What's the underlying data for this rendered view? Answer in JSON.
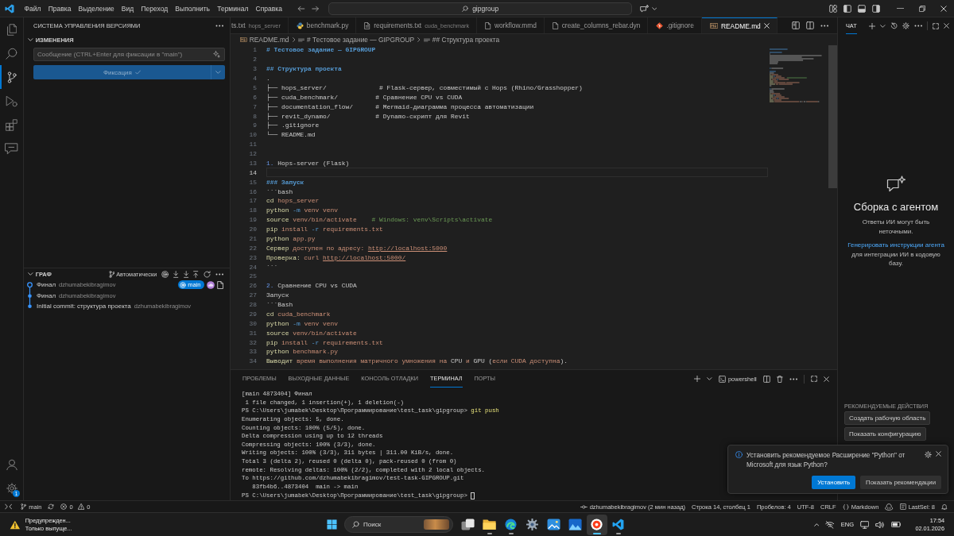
{
  "title_bar": {
    "menu": [
      "Файл",
      "Правка",
      "Выделение",
      "Вид",
      "Переход",
      "Выполнить",
      "Терминал",
      "Справка"
    ],
    "command_center": "gipgroup"
  },
  "activity_bar": {
    "items": [
      {
        "kind": "files",
        "selected": false
      },
      {
        "kind": "search",
        "selected": false
      },
      {
        "kind": "source-control",
        "selected": true
      },
      {
        "kind": "run",
        "selected": false
      },
      {
        "kind": "extensions",
        "selected": false
      },
      {
        "kind": "chat",
        "selected": false
      }
    ],
    "bottom": [
      {
        "kind": "account"
      },
      {
        "kind": "settings",
        "badge": "1"
      }
    ]
  },
  "source_control": {
    "title": "СИСТЕМА УПРАВЛЕНИЯ ВЕРСИЯМИ",
    "changes": {
      "title": "ИЗМЕНЕНИЯ",
      "expanded": true,
      "message": {
        "placeholder": "Сообщение (CTRL+Enter для фиксации в \"main\")"
      },
      "commit_button": {
        "label": "Фиксация",
        "disabled": true
      }
    },
    "graph": {
      "title": "ГРАФ",
      "expanded": true,
      "mode": "Автоматически",
      "commits": [
        {
          "message": "Финал",
          "author": "dzhumabekibragimov",
          "head": true,
          "branch": "main",
          "remote": true,
          "actions": true
        },
        {
          "message": "Финал",
          "author": "dzhumabekibragimov",
          "head": false,
          "remote": false,
          "actions": false
        },
        {
          "message": "Initial commit: структура проекта",
          "author": "dzhumabekibragimov",
          "head": false,
          "remote": false,
          "actions": false
        }
      ]
    }
  },
  "editor": {
    "tabs": [
      {
        "label": "ts.txt",
        "description": "hops_server",
        "kind": "none",
        "selected": false
      },
      {
        "label": "benchmark.py",
        "kind": "python",
        "selected": false
      },
      {
        "label": "requirements.txt",
        "description": "cuda_benchmark",
        "kind": "lines",
        "selected": false
      },
      {
        "label": "workflow.mmd",
        "kind": "file",
        "selected": false
      },
      {
        "label": "create_columns_rebar.dyn",
        "kind": "file",
        "selected": false
      },
      {
        "label": ".gitignore",
        "kind": "git",
        "selected": false
      },
      {
        "label": "README.md",
        "kind": "markdown",
        "selected": true
      }
    ],
    "breadcrumb": [
      {
        "label": "README.md",
        "kind": "markdown"
      },
      {
        "label": "# Тестовое задание — GIPGROUP",
        "kind": "symbol"
      },
      {
        "label": "## Структура проекта",
        "kind": "symbol"
      }
    ],
    "lines": [
      {
        "number": "1",
        "current": false,
        "segments": [
          {
            "kind": "heading",
            "text": "# Тестовое задание — GIPGROUP"
          }
        ]
      },
      {
        "number": "2",
        "current": false
      },
      {
        "number": "3",
        "current": false,
        "segments": [
          {
            "kind": "heading",
            "text": "## Структура проекта"
          }
        ]
      },
      {
        "number": "4",
        "current": false,
        "segments": [
          {
            "kind": "text",
            "text": "."
          }
        ]
      },
      {
        "number": "5",
        "current": false,
        "segments": [
          {
            "kind": "text",
            "text": "├── hops_server/              # Flask-сервер, совместимый с Hops (Rhino/Grasshopper)"
          }
        ]
      },
      {
        "number": "6",
        "current": false,
        "segments": [
          {
            "kind": "text",
            "text": "├── cuda_benchmark/          # Сравнение CPU vs CUDA"
          }
        ]
      },
      {
        "number": "7",
        "current": false,
        "segments": [
          {
            "kind": "text",
            "text": "├── documentation_flow/      # Mermaid-диаграмма процесса автоматизации"
          }
        ]
      },
      {
        "number": "8",
        "current": false,
        "segments": [
          {
            "kind": "text",
            "text": "├── revit_dynamo/            # Dynamo-скрипт для Revit"
          }
        ]
      },
      {
        "number": "9",
        "current": false,
        "segments": [
          {
            "kind": "text",
            "text": "├── .gitignore"
          }
        ]
      },
      {
        "number": "10",
        "current": false,
        "segments": [
          {
            "kind": "text",
            "text": "└── README.md"
          }
        ]
      },
      {
        "number": "11",
        "current": false
      },
      {
        "number": "12",
        "current": false
      },
      {
        "number": "13",
        "current": false,
        "segments": [
          {
            "kind": "marker",
            "text": "1."
          },
          {
            "kind": "text",
            "text": " Hops-server (Flask)"
          }
        ]
      },
      {
        "number": "14",
        "current": true
      },
      {
        "number": "15",
        "current": false,
        "segments": [
          {
            "kind": "heading",
            "text": "### Запуск"
          }
        ]
      },
      {
        "number": "16",
        "current": false,
        "segments": [
          {
            "kind": "text",
            "text": "```bash"
          }
        ]
      },
      {
        "number": "17",
        "current": false,
        "segments": [
          {
            "kind": "command",
            "text": "cd"
          },
          {
            "kind": "string",
            "text": " hops_server"
          }
        ]
      },
      {
        "number": "18",
        "current": false,
        "segments": [
          {
            "kind": "command",
            "text": "python"
          },
          {
            "kind": "flag",
            "text": " -m"
          },
          {
            "kind": "string",
            "text": " venv venv"
          }
        ]
      },
      {
        "number": "19",
        "current": false,
        "segments": [
          {
            "kind": "command",
            "text": "source"
          },
          {
            "kind": "string",
            "text": " venv/bin/activate"
          },
          {
            "kind": "comment",
            "text": "    # Windows: venv\\Scripts\\activate"
          }
        ]
      },
      {
        "number": "20",
        "current": false,
        "segments": [
          {
            "kind": "command",
            "text": "pip"
          },
          {
            "kind": "string",
            "text": " install"
          },
          {
            "kind": "flag",
            "text": " -r"
          },
          {
            "kind": "string",
            "text": " requirements.txt"
          }
        ]
      },
      {
        "number": "21",
        "current": false,
        "segments": [
          {
            "kind": "command",
            "text": "python"
          },
          {
            "kind": "string",
            "text": " app.py"
          }
        ]
      },
      {
        "number": "22",
        "current": false,
        "segments": [
          {
            "kind": "command",
            "text": "Сервер"
          },
          {
            "kind": "string",
            "text": " доступен по адресу: "
          },
          {
            "kind": "link",
            "text": "http://localhost:5000"
          }
        ]
      },
      {
        "number": "23",
        "current": false,
        "segments": [
          {
            "kind": "command",
            "text": "Проверка:"
          },
          {
            "kind": "string",
            "text": " curl "
          },
          {
            "kind": "link",
            "text": "http://localhost:5000/"
          }
        ]
      },
      {
        "number": "24",
        "current": false,
        "segments": [
          {
            "kind": "text",
            "text": "```"
          }
        ]
      },
      {
        "number": "25",
        "current": false
      },
      {
        "number": "26",
        "current": false,
        "segments": [
          {
            "kind": "marker",
            "text": "2."
          },
          {
            "kind": "text",
            "text": " Сравнение CPU vs CUDA"
          }
        ]
      },
      {
        "number": "27",
        "current": false,
        "segments": [
          {
            "kind": "text",
            "text": "Запуск"
          }
        ]
      },
      {
        "number": "28",
        "current": false,
        "segments": [
          {
            "kind": "text",
            "text": "```Bash"
          }
        ]
      },
      {
        "number": "29",
        "current": false,
        "segments": [
          {
            "kind": "command",
            "text": "cd"
          },
          {
            "kind": "string",
            "text": " cuda_benchmark"
          }
        ]
      },
      {
        "number": "30",
        "current": false,
        "segments": [
          {
            "kind": "command",
            "text": "python"
          },
          {
            "kind": "flag",
            "text": " -m"
          },
          {
            "kind": "string",
            "text": " venv venv"
          }
        ]
      },
      {
        "number": "31",
        "current": false,
        "segments": [
          {
            "kind": "command",
            "text": "source"
          },
          {
            "kind": "string",
            "text": " venv/bin/activate"
          }
        ]
      },
      {
        "number": "32",
        "current": false,
        "segments": [
          {
            "kind": "command",
            "text": "pip"
          },
          {
            "kind": "string",
            "text": " install"
          },
          {
            "kind": "flag",
            "text": " -r"
          },
          {
            "kind": "string",
            "text": " requirements.txt"
          }
        ]
      },
      {
        "number": "33",
        "current": false,
        "segments": [
          {
            "kind": "command",
            "text": "python"
          },
          {
            "kind": "string",
            "text": " benchmark.py"
          }
        ]
      },
      {
        "number": "34",
        "current": false,
        "segments": [
          {
            "kind": "command",
            "text": "Выводит"
          },
          {
            "kind": "string",
            "text": " время выполнения матричного умножения на "
          },
          {
            "kind": "text",
            "text": "CPU"
          },
          {
            "kind": "string",
            "text": " и "
          },
          {
            "kind": "text",
            "text": "GPU"
          },
          {
            "kind": "text",
            "text": " ("
          },
          {
            "kind": "string",
            "text": "если CUDA доступна"
          },
          {
            "kind": "text",
            "text": ")."
          }
        ]
      }
    ]
  },
  "panel": {
    "tabs": [
      {
        "label": "ПРОБЛЕМЫ",
        "selected": false
      },
      {
        "label": "ВЫХОДНЫЕ ДАННЫЕ",
        "selected": false
      },
      {
        "label": "КОНСОЛЬ ОТЛАДКИ",
        "selected": false
      },
      {
        "label": "ТЕРМИНАЛ",
        "selected": true
      },
      {
        "label": "ПОРТЫ",
        "selected": false
      }
    ],
    "shell": "powershell",
    "terminal": {
      "cursor": true,
      "lines": [
        [
          {
            "kind": "output",
            "text": "[main 4873404] Финал"
          }
        ],
        [
          {
            "kind": "output",
            "text": " 1 file changed, 1 insertion(+), 1 deletion(-)"
          }
        ],
        [
          {
            "kind": "output",
            "text": "PS C:\\Users\\jumabek\\Desktop\\Программирование\\test_task\\gipgroup> "
          },
          {
            "kind": "command",
            "text": "git push"
          }
        ],
        [
          {
            "kind": "output",
            "text": "Enumerating objects: 5, done."
          }
        ],
        [
          {
            "kind": "output",
            "text": "Counting objects: 100% (5/5), done."
          }
        ],
        [
          {
            "kind": "output",
            "text": "Delta compression using up to 12 threads"
          }
        ],
        [
          {
            "kind": "output",
            "text": "Compressing objects: 100% (3/3), done."
          }
        ],
        [
          {
            "kind": "output",
            "text": "Writing objects: 100% (3/3), 311 bytes | 311.00 KiB/s, done."
          }
        ],
        [
          {
            "kind": "output",
            "text": "Total 3 (delta 2), reused 0 (delta 0), pack-reused 0 (from 0)"
          }
        ],
        [
          {
            "kind": "output",
            "text": "remote: Resolving deltas: 100% (2/2), completed with 2 local objects."
          }
        ],
        [
          {
            "kind": "output",
            "text": "To https://github.com/dzhumabekibragimov/test-task-GIPGROUP.git"
          }
        ],
        [
          {
            "kind": "output",
            "text": "   83fb4b6..4873404  main -> main"
          }
        ],
        [
          {
            "kind": "output",
            "text": "PS C:\\Users\\jumabek\\Desktop\\Программирование\\test_task\\gipgroup> "
          }
        ]
      ]
    }
  },
  "chat": {
    "tabs": [
      {
        "label": "ЧАТ",
        "selected": true
      }
    ],
    "title": "Сборка с агентом",
    "note": "Ответы ИИ могут быть неточными.",
    "hint": {
      "link": "Генерировать инструкции агента",
      "text": "для интеграции ИИ в кодовую базу."
    },
    "recommended": {
      "title": "РЕКОМЕНДУЕМЫЕ ДЕЙСТВИЯ",
      "actions": [
        "Создать рабочую область",
        "Показать конфигурацию"
      ]
    }
  },
  "notification": {
    "message": "Установить рекомендуемое Расширение \"Python\" от Microsoft для язык Python?",
    "buttons": [
      {
        "label": "Установить",
        "primary": true
      },
      {
        "label": "Показать рекомендации",
        "primary": false
      }
    ]
  },
  "status_bar": {
    "branch": "main",
    "errors": "0",
    "warnings": "0",
    "items": [
      {
        "kind": "blame",
        "label": "dzhumabekibragimov (2 мин назад)"
      },
      {
        "kind": "text",
        "label": "Строка 14, столбец 1"
      },
      {
        "kind": "text",
        "label": "Пробелов: 4"
      },
      {
        "kind": "text",
        "label": "UTF-8"
      },
      {
        "kind": "text",
        "label": "CRLF"
      },
      {
        "kind": "language",
        "label": "Markdown"
      },
      {
        "kind": "copilot"
      },
      {
        "kind": "lastsel",
        "label": "LastSel: 8"
      },
      {
        "kind": "bell"
      }
    ]
  },
  "taskbar": {
    "notice": {
      "title": "Предупрежден...",
      "text": "Только выпуще..."
    },
    "search": {
      "placeholder": "Поиск"
    },
    "apps": [
      {
        "kind": "task-view",
        "running": false,
        "selected": false
      },
      {
        "kind": "folder",
        "running": true,
        "selected": false
      },
      {
        "kind": "swirl",
        "running": true,
        "selected": false
      },
      {
        "kind": "gear",
        "running": false,
        "selected": false
      },
      {
        "kind": "photo",
        "running": false,
        "selected": false
      },
      {
        "kind": "landscape",
        "running": false,
        "selected": false
      },
      {
        "kind": "round",
        "running": true,
        "selected": true
      },
      {
        "kind": "code",
        "running": true,
        "selected": false
      }
    ],
    "tray": {
      "language": "ENG",
      "time": "17:54",
      "date": "02.01.2026"
    }
  }
}
